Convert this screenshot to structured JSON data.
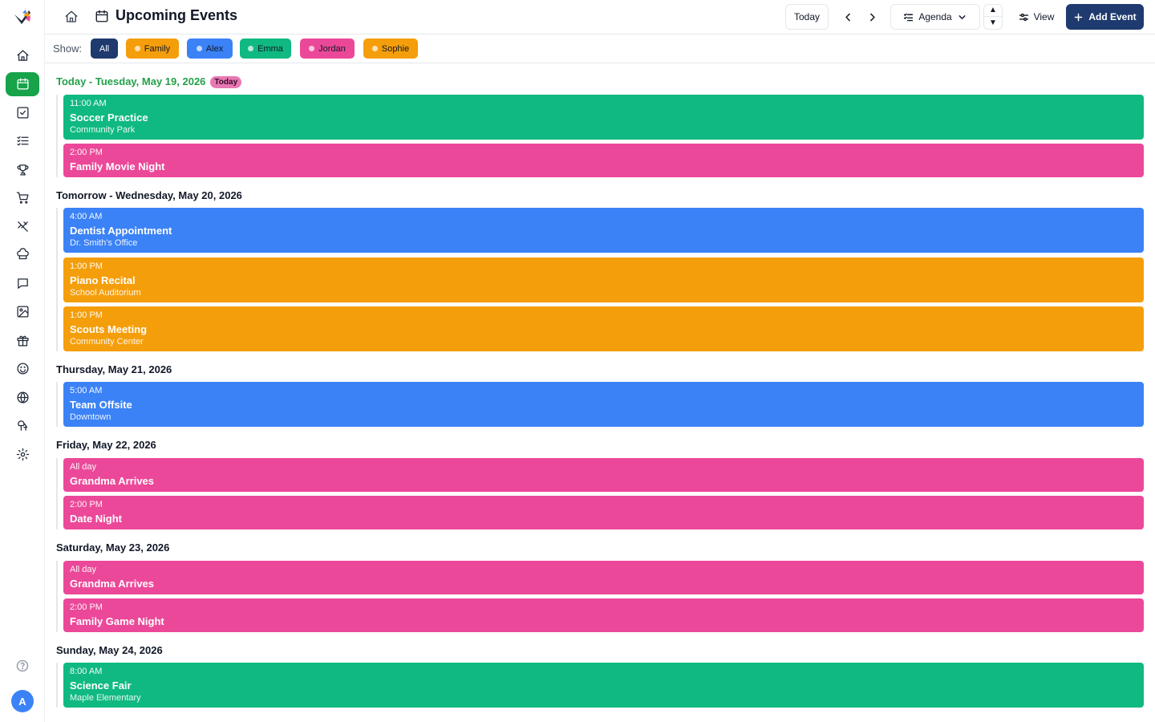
{
  "header": {
    "title": "Upcoming Events",
    "today_label": "Today",
    "view_mode": "Agenda",
    "view_label": "View",
    "add_event_label": "Add Event"
  },
  "filters": {
    "label": "Show:",
    "chips": [
      {
        "label": "All",
        "color": "#1e3a6e"
      },
      {
        "label": "Family",
        "color": "#f59e0b"
      },
      {
        "label": "Alex",
        "color": "#3b82f6"
      },
      {
        "label": "Emma",
        "color": "#10b981"
      },
      {
        "label": "Jordan",
        "color": "#ec4899"
      },
      {
        "label": "Sophie",
        "color": "#f59e0b"
      }
    ]
  },
  "sidebar": {
    "items": [
      {
        "icon": "home-icon"
      },
      {
        "icon": "calendar-icon",
        "active": true
      },
      {
        "icon": "checkbox-icon"
      },
      {
        "icon": "list-check-icon"
      },
      {
        "icon": "trophy-icon"
      },
      {
        "icon": "cart-icon"
      },
      {
        "icon": "utensils-icon"
      },
      {
        "icon": "chef-hat-icon"
      },
      {
        "icon": "chat-icon"
      },
      {
        "icon": "image-icon"
      },
      {
        "icon": "gift-icon"
      },
      {
        "icon": "smile-icon"
      },
      {
        "icon": "globe-icon"
      },
      {
        "icon": "trees-icon"
      },
      {
        "icon": "settings-icon"
      }
    ],
    "avatar_initial": "A"
  },
  "agenda": [
    {
      "label": "Today - Tuesday, May 19, 2026",
      "is_today": true,
      "badge": "Today",
      "events": [
        {
          "time": "11:00 AM",
          "title": "Soccer Practice",
          "location": "Community Park",
          "color": "#10b981"
        },
        {
          "time": "2:00 PM",
          "title": "Family Movie Night",
          "location": "",
          "color": "#ec4899"
        }
      ]
    },
    {
      "label": "Tomorrow - Wednesday, May 20, 2026",
      "events": [
        {
          "time": "4:00 AM",
          "title": "Dentist Appointment",
          "location": "Dr. Smith's Office",
          "color": "#3b82f6"
        },
        {
          "time": "1:00 PM",
          "title": "Piano Recital",
          "location": "School Auditorium",
          "color": "#f59e0b"
        },
        {
          "time": "1:00 PM",
          "title": "Scouts Meeting",
          "location": "Community Center",
          "color": "#f59e0b"
        }
      ]
    },
    {
      "label": "Thursday, May 21, 2026",
      "events": [
        {
          "time": "5:00 AM",
          "title": "Team Offsite",
          "location": "Downtown",
          "color": "#3b82f6"
        }
      ]
    },
    {
      "label": "Friday, May 22, 2026",
      "events": [
        {
          "time": "All day",
          "title": "Grandma Arrives",
          "location": "",
          "color": "#ec4899"
        },
        {
          "time": "2:00 PM",
          "title": "Date Night",
          "location": "",
          "color": "#ec4899"
        }
      ]
    },
    {
      "label": "Saturday, May 23, 2026",
      "events": [
        {
          "time": "All day",
          "title": "Grandma Arrives",
          "location": "",
          "color": "#ec4899"
        },
        {
          "time": "2:00 PM",
          "title": "Family Game Night",
          "location": "",
          "color": "#ec4899"
        }
      ]
    },
    {
      "label": "Sunday, May 24, 2026",
      "events": [
        {
          "time": "8:00 AM",
          "title": "Science Fair",
          "location": "Maple Elementary",
          "color": "#10b981"
        }
      ]
    }
  ]
}
